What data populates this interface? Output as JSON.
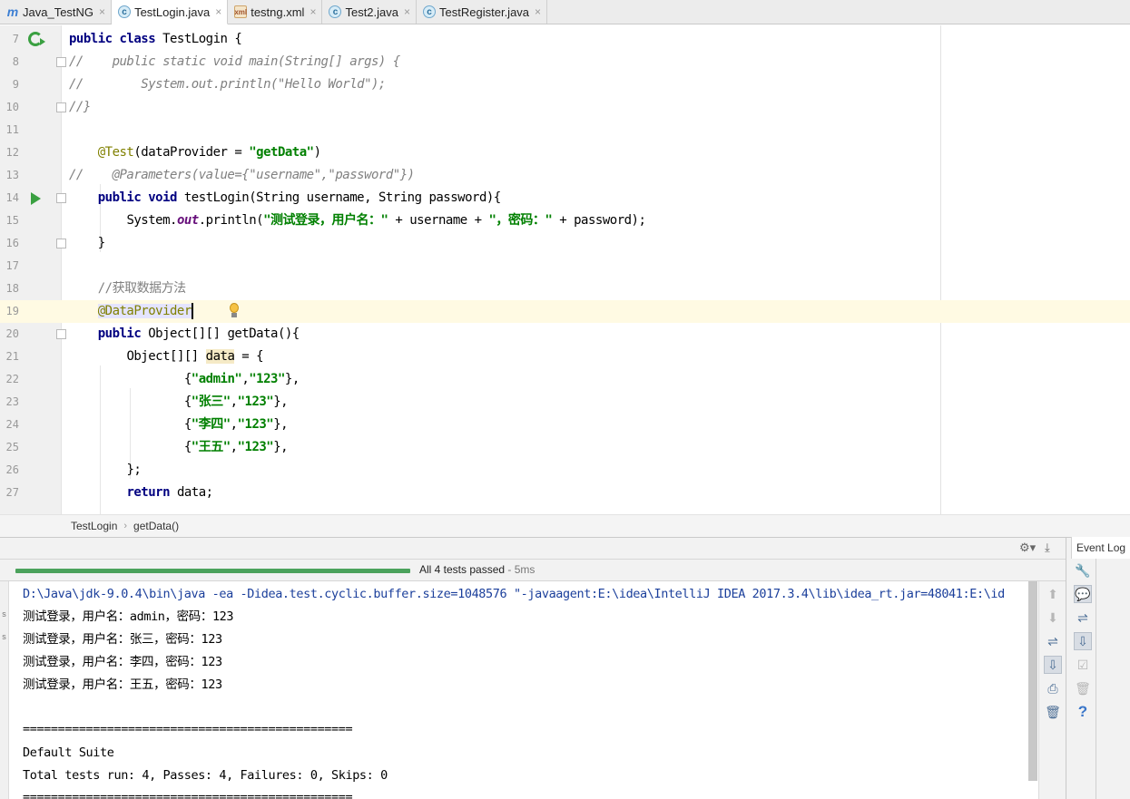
{
  "tabs": [
    {
      "label": "Java_TestNG",
      "icon": "module-icon",
      "active": false
    },
    {
      "label": "TestLogin.java",
      "icon": "java-class-icon",
      "active": true
    },
    {
      "label": "testng.xml",
      "icon": "xml-file-icon",
      "active": false
    },
    {
      "label": "Test2.java",
      "icon": "java-class-icon",
      "active": false
    },
    {
      "label": "TestRegister.java",
      "icon": "java-class-icon",
      "active": false
    }
  ],
  "tab_close_glyph": "×",
  "editor": {
    "line_numbers": [
      "7",
      "8",
      "9",
      "10",
      "11",
      "12",
      "13",
      "14",
      "15",
      "16",
      "17",
      "18",
      "19",
      "20",
      "21",
      "22",
      "23",
      "24",
      "25",
      "26",
      "27"
    ],
    "l7": {
      "kw": "public class ",
      "rest": "TestLogin {"
    },
    "l8": "//    public static void main(String[] args) {",
    "l9": "//        System.out.println(\"Hello World\");",
    "l10": "//}",
    "l12": {
      "ann": "@Test",
      "p1": "(dataProvider = ",
      "str": "\"getData\"",
      "p2": ")"
    },
    "l13": "//    @Parameters(value={\"username\",\"password\"})",
    "l14": {
      "kw": "public void ",
      "rest": "testLogin(String username, String password){"
    },
    "l15": {
      "p1": "System.",
      "st": "out",
      "p2": ".println(",
      "s1": "\"测试登录，用户名：\"",
      "p3": " + username + ",
      "s2": "\"，密码：\"",
      "p4": " + password);"
    },
    "l16": "}",
    "l18": "//获取数据方法",
    "l19": "@DataProvider",
    "l20": {
      "kw": "public ",
      "rest": "Object[][] getData(){"
    },
    "l21": {
      "p1": "Object[][] ",
      "var": "data",
      "p2": " = {"
    },
    "l22": {
      "p1": "{",
      "s1": "\"admin\"",
      "p2": ",",
      "s2": "\"123\"",
      "p3": "},"
    },
    "l23": {
      "p1": "{",
      "s1": "\"张三\"",
      "p2": ",",
      "s2": "\"123\"",
      "p3": "},"
    },
    "l24": {
      "p1": "{",
      "s1": "\"李四\"",
      "p2": ",",
      "s2": "\"123\"",
      "p3": "},"
    },
    "l25": {
      "p1": "{",
      "s1": "\"王五\"",
      "p2": ",",
      "s2": "\"123\"",
      "p3": "},"
    },
    "l26": "};",
    "l27": {
      "kw": "return ",
      "rest": "data;"
    }
  },
  "breadcrumb": [
    "TestLogin",
    "getData()"
  ],
  "breadcrumb_sep": "›",
  "run": {
    "status": "All 4 tests passed",
    "duration": " - 5ms",
    "progress_fraction": 1.0,
    "console": [
      "D:\\Java\\jdk-9.0.4\\bin\\java -ea -Didea.test.cyclic.buffer.size=1048576 \"-javaagent:E:\\idea\\IntelliJ IDEA 2017.3.4\\lib\\idea_rt.jar=48041:E:\\id",
      "测试登录，用户名：admin，密码：123",
      "测试登录，用户名：张三，密码：123",
      "测试登录，用户名：李四，密码：123",
      "测试登录，用户名：王五，密码：123",
      "",
      "===============================================",
      "Default Suite",
      "Total tests run: 4, Passes: 4, Failures: 0, Skips: 0",
      "==============================================="
    ]
  },
  "event_log": "Event Log",
  "colors": {
    "pass_green": "#4ba25c",
    "keyword": "#000080",
    "string": "#008000",
    "annotation": "#808000",
    "comment": "#808080"
  }
}
